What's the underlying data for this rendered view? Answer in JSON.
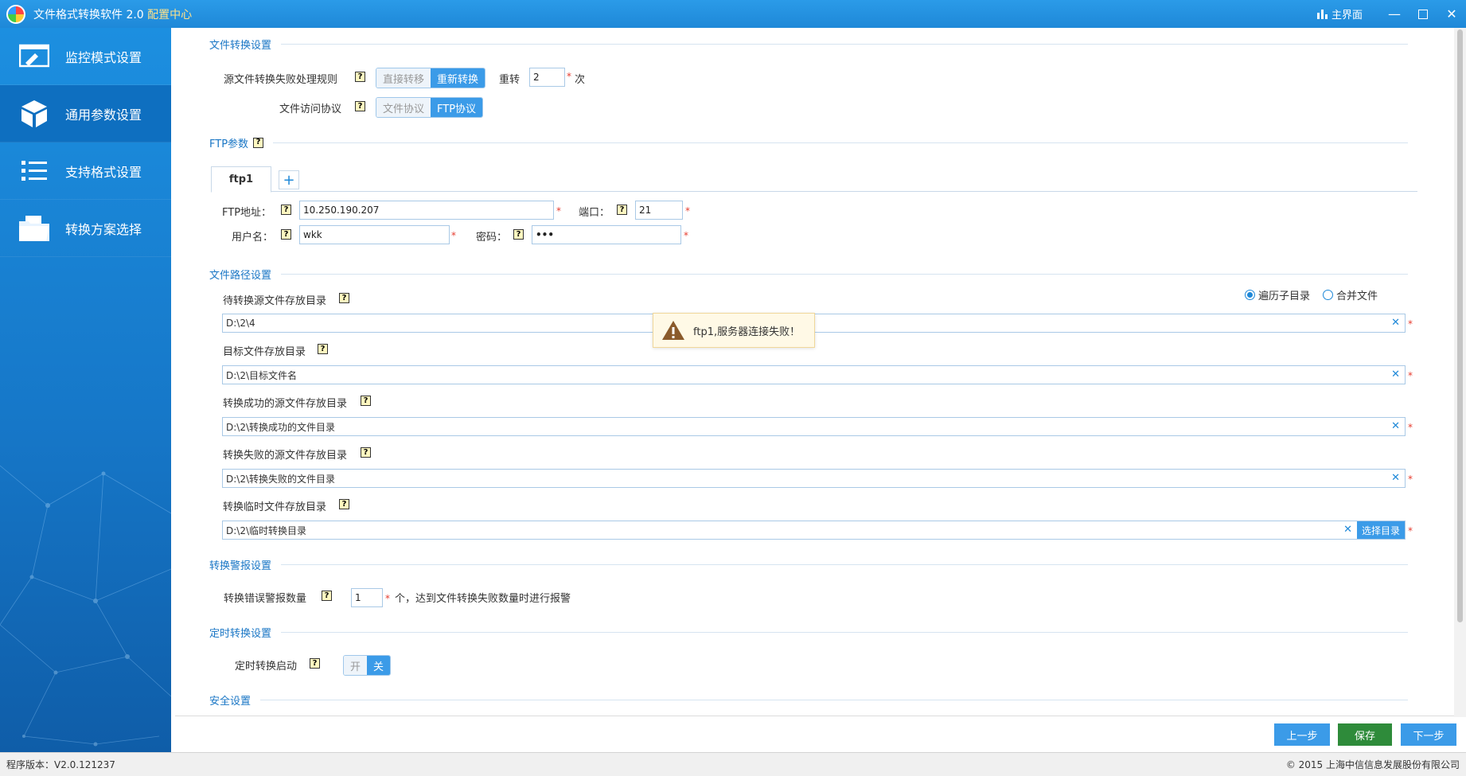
{
  "window": {
    "title": "文件格式转换软件 2.0",
    "subtitle": "配置中心",
    "home_label": "主界面"
  },
  "sidebar": {
    "items": [
      {
        "label": "监控模式设置",
        "icon": "monitor-edit-icon"
      },
      {
        "label": "通用参数设置",
        "icon": "cube-icon"
      },
      {
        "label": "支持格式设置",
        "icon": "list-icon"
      },
      {
        "label": "转换方案选择",
        "icon": "folder-icon"
      }
    ],
    "active_index": 1
  },
  "sections": {
    "file_convert": "文件转换设置",
    "ftp_params": "FTP参数",
    "file_paths": "文件路径设置",
    "alarm": "转换警报设置",
    "scheduled": "定时转换设置",
    "security": "安全设置"
  },
  "convert": {
    "fail_rule_label": "源文件转换失败处理规则",
    "fail_rule_options": [
      "直接转移",
      "重新转换"
    ],
    "fail_rule_selected": "重新转换",
    "retry_label": "重转",
    "retry_value": "2",
    "retry_unit": "次",
    "protocol_label": "文件访问协议",
    "protocol_options": [
      "文件协议",
      "FTP协议"
    ],
    "protocol_selected": "FTP协议"
  },
  "ftp": {
    "tab_name": "ftp1",
    "address_label": "FTP地址：",
    "address_value": "10.250.190.207",
    "port_label": "端口：",
    "port_value": "21",
    "user_label": "用户名：",
    "user_value": "wkk",
    "password_label": "密码：",
    "password_value": "•••"
  },
  "paths": {
    "source_label": "待转换源文件存放目录",
    "source_value": "D:\\2\\4",
    "target_label": "目标文件存放目录",
    "target_value": "D:\\2\\目标文件名",
    "success_label": "转换成功的源文件存放目录",
    "success_value": "D:\\2\\转换成功的文件目录",
    "failed_label": "转换失败的源文件存放目录",
    "failed_value": "D:\\2\\转换失败的文件目录",
    "temp_label": "转换临时文件存放目录",
    "temp_value": "D:\\2\\临时转换目录",
    "choose_dir": "选择目录",
    "mode_options": [
      "遍历子目录",
      "合并文件"
    ],
    "mode_selected": "遍历子目录"
  },
  "alarm": {
    "label": "转换错误警报数量",
    "value": "1",
    "suffix": "个，达到文件转换失败数量时进行报警"
  },
  "scheduled": {
    "label": "定时转换启动",
    "options": [
      "开",
      "关"
    ],
    "selected": "关"
  },
  "toast": {
    "message": "ftp1,服务器连接失败！"
  },
  "buttons": {
    "prev": "上一步",
    "save": "保存",
    "next": "下一步"
  },
  "status": {
    "version": "程序版本：V2.0.121237",
    "copyright": "© 2015 上海中信信息发展股份有限公司"
  },
  "colors": {
    "accent": "#1e88d8",
    "save_button": "#2e8b3a",
    "required": "#e63c2f"
  }
}
